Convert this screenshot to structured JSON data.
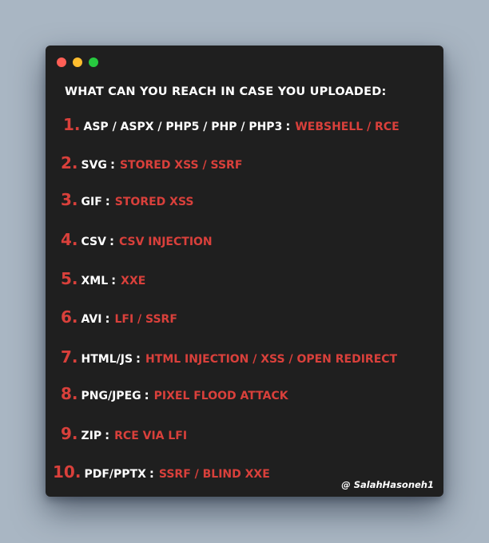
{
  "heading": "WHAT CAN YOU REACH IN CASE YOU UPLOADED:",
  "items": [
    {
      "num": "1.",
      "key": "ASP / ASPX / PHP5 / PHP / PHP3",
      "val": "WEBSHELL / RCE"
    },
    {
      "num": "2.",
      "key": "SVG",
      "val": "STORED XSS / SSRF"
    },
    {
      "num": "3.",
      "key": "GIF",
      "val": "STORED XSS"
    },
    {
      "num": "4.",
      "key": "CSV",
      "val": "CSV INJECTION"
    },
    {
      "num": "5.",
      "key": "XML",
      "val": "XXE"
    },
    {
      "num": "6.",
      "key": "AVI",
      "val": "LFI / SSRF"
    },
    {
      "num": "7.",
      "key": "HTML/JS",
      "val": "HTML INJECTION / XSS / OPEN REDIRECT"
    },
    {
      "num": "8.",
      "key": "PNG/JPEG",
      "val": "PIXEL FLOOD ATTACK"
    },
    {
      "num": "9.",
      "key": "ZIP",
      "val": "RCE VIA LFI"
    },
    {
      "num": "10.",
      "key": "PDF/PPTX",
      "val": "SSRF / BLIND XXE"
    }
  ],
  "credit": "@ SalahHasoneh1",
  "colors": {
    "background": "#a9b6c3",
    "window": "#1f1f1f",
    "accent": "#d9403b",
    "text": "#ffffff"
  }
}
